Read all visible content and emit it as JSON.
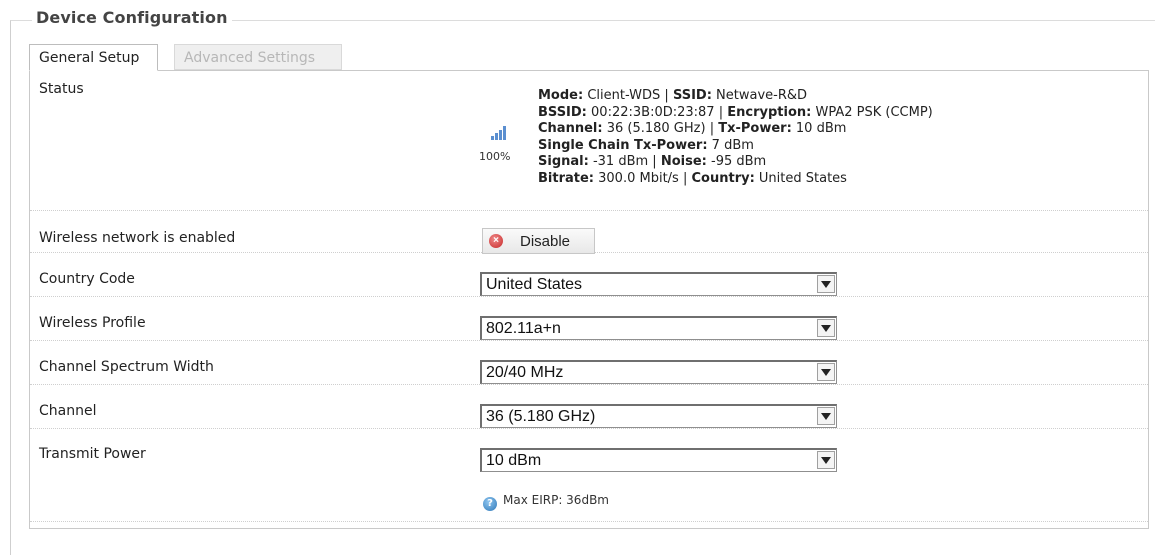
{
  "section": {
    "legend": "Device Configuration"
  },
  "tabs": [
    {
      "label": "General Setup",
      "active": true
    },
    {
      "label": "Advanced Settings",
      "active": false
    }
  ],
  "status": {
    "label": "Status",
    "signal_percent": "100%",
    "mode_label": "Mode:",
    "mode_value": "Client-WDS",
    "ssid_label": "SSID:",
    "ssid_value": "Netwave-R&D",
    "bssid_label": "BSSID:",
    "bssid_value": "00:22:3B:0D:23:87",
    "encryption_label": "Encryption:",
    "encryption_value": "WPA2 PSK (CCMP)",
    "channel_label": "Channel:",
    "channel_value": "36 (5.180 GHz)",
    "txpower_label": "Tx-Power:",
    "txpower_value": "10 dBm",
    "single_chain_label": "Single Chain Tx-Power:",
    "single_chain_value": "7 dBm",
    "signal_label": "Signal:",
    "signal_value": "-31 dBm",
    "noise_label": "Noise:",
    "noise_value": "-95 dBm",
    "bitrate_label": "Bitrate:",
    "bitrate_value": "300.0 Mbit/s",
    "country_label": "Country:",
    "country_value": "United States",
    "separator": "|"
  },
  "wireless": {
    "label": "Wireless network is enabled",
    "button_label": "Disable"
  },
  "fields": [
    {
      "label": "Country Code",
      "value": "United States"
    },
    {
      "label": "Wireless Profile",
      "value": "802.11a+n"
    },
    {
      "label": "Channel Spectrum Width",
      "value": "20/40 MHz"
    },
    {
      "label": "Channel",
      "value": "36 (5.180 GHz)"
    },
    {
      "label": "Transmit Power",
      "value": "10 dBm"
    }
  ],
  "help": {
    "text": "Max EIRP: 36dBm"
  },
  "colors": {
    "signal_bars": "#5b8fd0",
    "disable_icon": "#c62828",
    "help_icon": "#2f78b8"
  }
}
